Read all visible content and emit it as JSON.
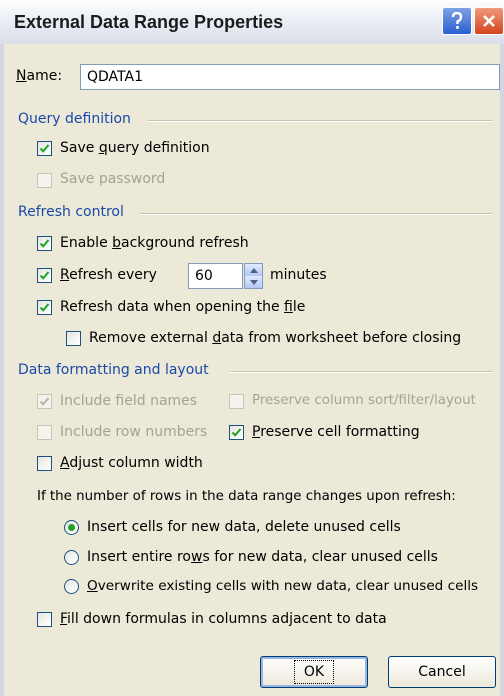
{
  "window": {
    "title": "External Data Range Properties",
    "help_icon": "help-icon",
    "close_icon": "close-icon"
  },
  "name": {
    "label": "Name:",
    "value": "QDATA1"
  },
  "query_definition": {
    "heading": "Query definition",
    "save_query": {
      "label": "Save query definition",
      "checked": true
    },
    "save_password": {
      "label": "Save password",
      "checked": false,
      "disabled": true
    }
  },
  "refresh_control": {
    "heading": "Refresh control",
    "background": {
      "label": "Enable background refresh",
      "checked": true
    },
    "every": {
      "label": "Refresh every",
      "checked": true,
      "value": "60",
      "unit": "minutes"
    },
    "on_open": {
      "label": "Refresh data when opening the file",
      "checked": true
    },
    "remove_external": {
      "label": "Remove external data from worksheet before closing",
      "checked": false
    }
  },
  "formatting": {
    "heading": "Data formatting and layout",
    "include_field_names": {
      "label": "Include field names",
      "checked": true,
      "disabled": true
    },
    "preserve_sort": {
      "label": "Preserve column sort/filter/layout",
      "checked": false,
      "disabled": true
    },
    "include_row_numbers": {
      "label": "Include row numbers",
      "checked": false,
      "disabled": true
    },
    "preserve_cell_formatting": {
      "label": "Preserve cell formatting",
      "checked": true
    },
    "adjust_width": {
      "label": "Adjust column width",
      "checked": false
    },
    "rows_change_prompt": "If the number of rows in the data range changes upon refresh:",
    "options": [
      {
        "label": "Insert cells for new data, delete unused cells",
        "selected": true
      },
      {
        "label": "Insert entire rows for new data, clear unused cells",
        "selected": false
      },
      {
        "label": "Overwrite existing cells with new data, clear unused cells",
        "selected": false
      }
    ],
    "fill_down": {
      "label": "Fill down formulas in columns adjacent to data",
      "checked": false
    }
  },
  "buttons": {
    "ok": "OK",
    "cancel": "Cancel"
  },
  "colors": {
    "section_heading": "#1a49a8",
    "radio_dot": "#21a121",
    "window_bg": "#ece9d8"
  }
}
